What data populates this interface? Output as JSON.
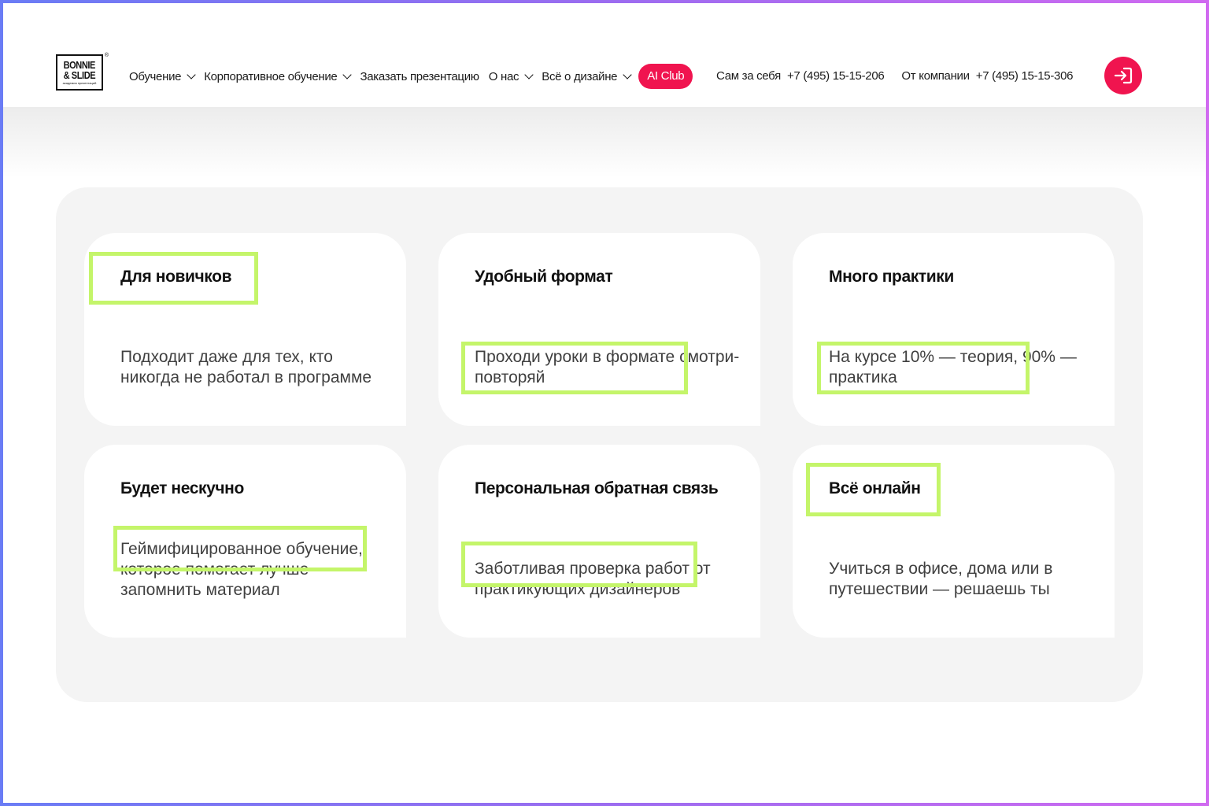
{
  "logo": {
    "line1": "BONNIE",
    "line2": "& SLIDE",
    "line3": "академия презентаций"
  },
  "nav": [
    {
      "label": "Обучение",
      "has_dropdown": true
    },
    {
      "label": "Корпоративное обучение",
      "has_dropdown": true
    },
    {
      "label": "Заказать презентацию",
      "has_dropdown": false
    },
    {
      "label": "О нас",
      "has_dropdown": true
    },
    {
      "label": "Всё о дизайне",
      "has_dropdown": true
    }
  ],
  "ai_club": "AI Club",
  "phones": {
    "self_label": "Сам за себя",
    "self_number": "+7 (495) 15-15-206",
    "company_label": "От компании",
    "company_number": "+7 (495) 15-15-306"
  },
  "login_icon": "login-arrow-icon",
  "colors": {
    "accent": "#f0144f",
    "highlight": "#c4f56a",
    "panel": "#f4f4f4"
  },
  "cards": [
    {
      "title": "Для новичков",
      "desc": "Подходит даже для тех, кто никогда не работал в программе"
    },
    {
      "title": "Удобный формат",
      "desc": "Проходи уроки в формате смотри-повторяй"
    },
    {
      "title": "Много практики",
      "desc": "На курсе 10% — теория, 90% — практика"
    },
    {
      "title": "Будет нескучно",
      "desc": "Геймифицированное обучение, которое помогает лучше запомнить материал"
    },
    {
      "title": "Персональная обратная связь",
      "desc": "Заботливая проверка работ от практикующих дизайнеров"
    },
    {
      "title": "Всё онлайн",
      "desc": "Учиться в офисе, дома или в путешествии — решаешь ты"
    }
  ]
}
